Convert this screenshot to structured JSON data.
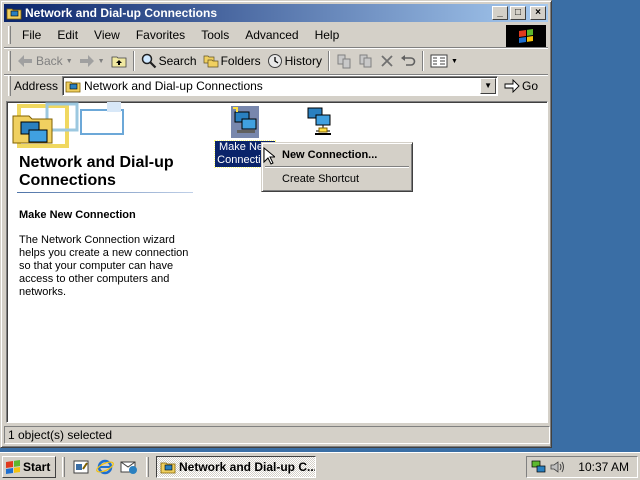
{
  "window": {
    "title": "Network and Dial-up Connections",
    "controls": {
      "minimize": "_",
      "maximize": "□",
      "close": "×"
    }
  },
  "menu": [
    "File",
    "Edit",
    "View",
    "Favorites",
    "Tools",
    "Advanced",
    "Help"
  ],
  "toolbar": {
    "back": "Back",
    "search": "Search",
    "folders": "Folders",
    "history": "History"
  },
  "address": {
    "label": "Address",
    "value": "Network and Dial-up Connections",
    "go": "Go"
  },
  "sidebar": {
    "title": "Network and Dial-up Connections",
    "subtitle": "Make New Connection",
    "description": "The Network Connection wizard helps you create a new connection so that your computer can have access to other computers and networks."
  },
  "icons": [
    {
      "label": "Make New Connection",
      "selected": true,
      "icon": "make-new-connection-icon"
    },
    {
      "label": "",
      "selected": false,
      "icon": "network-connection-icon"
    }
  ],
  "context_menu": {
    "items": [
      "New Connection...",
      "Create Shortcut"
    ]
  },
  "status": {
    "text": "1 object(s) selected"
  },
  "taskbar": {
    "start": "Start",
    "task": "Network and Dial-up C...",
    "clock": "10:37 AM"
  },
  "colors": {
    "titlebar_start": "#0a246a",
    "titlebar_end": "#a6caf0",
    "desktop": "#3a6ea5",
    "face": "#d4d0c8",
    "selection": "#0a246a"
  }
}
